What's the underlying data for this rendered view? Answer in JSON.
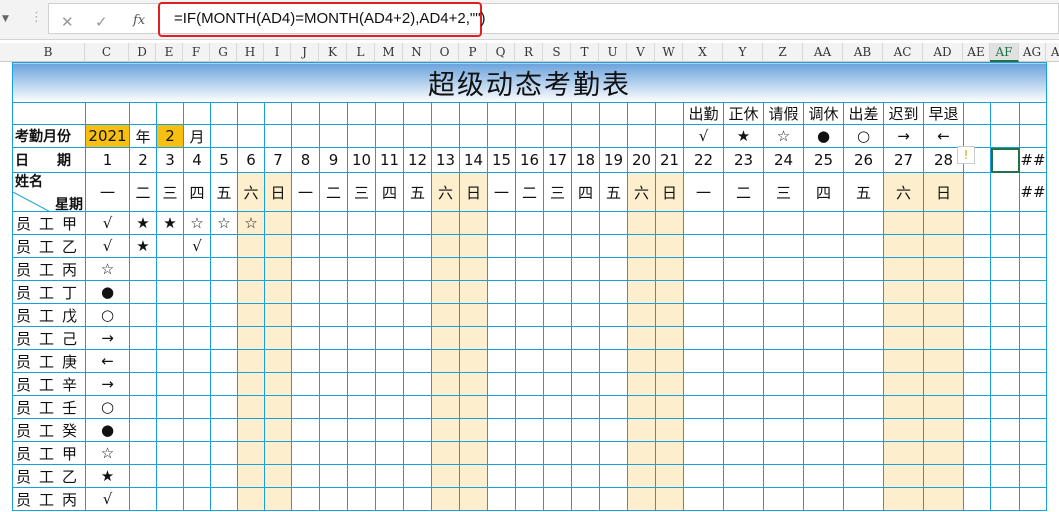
{
  "formula_bar": {
    "cancel": "✕",
    "enter": "✓",
    "fx": "fx",
    "formula": "=IF(MONTH(AD4)=MONTH(AD4+2),AD4+2,\"\")"
  },
  "columns": [
    "B",
    "C",
    "D",
    "E",
    "F",
    "G",
    "H",
    "I",
    "J",
    "K",
    "L",
    "M",
    "N",
    "O",
    "P",
    "Q",
    "R",
    "S",
    "T",
    "U",
    "V",
    "W",
    "X",
    "Y",
    "Z",
    "AA",
    "AB",
    "AC",
    "AD",
    "AE",
    "AF",
    "AG",
    "AH"
  ],
  "selected_column": "AF",
  "sheet": {
    "title": "超级动态考勤表",
    "month_label": "考勤月份",
    "year": "2021",
    "year_unit": "年",
    "month": "2",
    "month_unit": "月",
    "legend": [
      {
        "label": "出勤",
        "symbol": "√"
      },
      {
        "label": "正休",
        "symbol": "★"
      },
      {
        "label": "请假",
        "symbol": "☆"
      },
      {
        "label": "调休",
        "symbol": "●"
      },
      {
        "label": "出差",
        "symbol": "○"
      },
      {
        "label": "迟到",
        "symbol": "→"
      },
      {
        "label": "早退",
        "symbol": "←"
      }
    ],
    "date_label": "日　　期",
    "weekday_label": "星期",
    "name_label": "姓名",
    "days": [
      "1",
      "2",
      "3",
      "4",
      "5",
      "6",
      "7",
      "8",
      "9",
      "10",
      "11",
      "12",
      "13",
      "14",
      "15",
      "16",
      "17",
      "18",
      "19",
      "20",
      "21",
      "22",
      "23",
      "24",
      "25",
      "26",
      "27",
      "28"
    ],
    "weekdays": [
      "一",
      "二",
      "三",
      "四",
      "五",
      "六",
      "日",
      "一",
      "二",
      "三",
      "四",
      "五",
      "六",
      "日",
      "一",
      "二",
      "三",
      "四",
      "五",
      "六",
      "日",
      "一",
      "二",
      "三",
      "四",
      "五",
      "六",
      "日"
    ],
    "overflow": "##",
    "employees": [
      {
        "name": "员工甲",
        "marks": [
          "√",
          "★",
          "★",
          "☆",
          "☆",
          "☆"
        ]
      },
      {
        "name": "员工乙",
        "marks": [
          "√",
          "★",
          "",
          "√"
        ]
      },
      {
        "name": "员工丙",
        "marks": [
          "☆"
        ]
      },
      {
        "name": "员工丁",
        "marks": [
          "●"
        ]
      },
      {
        "name": "员工戊",
        "marks": [
          "○"
        ]
      },
      {
        "name": "员工己",
        "marks": [
          "→"
        ]
      },
      {
        "name": "员工庚",
        "marks": [
          "←"
        ]
      },
      {
        "name": "员工辛",
        "marks": [
          "→"
        ]
      },
      {
        "name": "员工壬",
        "marks": [
          "○"
        ]
      },
      {
        "name": "员工癸",
        "marks": [
          "●"
        ]
      },
      {
        "name": "员工甲",
        "marks": [
          "☆"
        ]
      },
      {
        "name": "员工乙",
        "marks": [
          "★"
        ]
      },
      {
        "name": "员工丙",
        "marks": [
          "√"
        ]
      }
    ]
  },
  "colors": {
    "grid": "#19a0d8",
    "weekend": "#fdefce",
    "highlight": "#f7bf11",
    "formula_outline": "#e02020",
    "selection": "#217346"
  }
}
